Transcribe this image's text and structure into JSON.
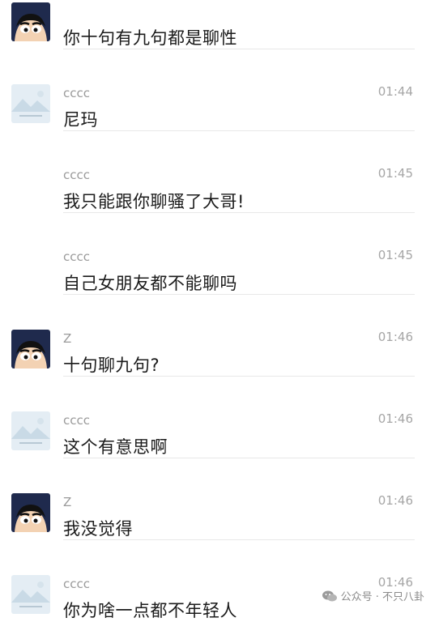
{
  "messages": [
    {
      "avatar": "crayon-shin-chan-avatar",
      "sender": "",
      "time": "",
      "text": "你十句有九句都是聊性",
      "show_avatar": true
    },
    {
      "avatar": "landscape-placeholder-avatar",
      "sender": "cccc",
      "time": "01:44",
      "text": "尼玛",
      "show_avatar": true
    },
    {
      "avatar": "",
      "sender": "cccc",
      "time": "01:45",
      "text": "我只能跟你聊骚了大哥!",
      "show_avatar": false
    },
    {
      "avatar": "",
      "sender": "cccc",
      "time": "01:45",
      "text": "自己女朋友都不能聊吗",
      "show_avatar": false
    },
    {
      "avatar": "crayon-shin-chan-avatar",
      "sender": "Z",
      "time": "01:46",
      "text": "十句聊九句?",
      "show_avatar": true
    },
    {
      "avatar": "landscape-placeholder-avatar",
      "sender": "cccc",
      "time": "01:46",
      "text": "这个有意思啊",
      "show_avatar": true
    },
    {
      "avatar": "crayon-shin-chan-avatar",
      "sender": "Z",
      "time": "01:46",
      "text": "我没觉得",
      "show_avatar": true
    },
    {
      "avatar": "landscape-placeholder-avatar",
      "sender": "cccc",
      "time": "01:46",
      "text": "你为啥一点都不年轻人",
      "show_avatar": true
    }
  ],
  "watermark": {
    "icon": "wechat-icon",
    "text": "公众号 · 不只八卦"
  }
}
